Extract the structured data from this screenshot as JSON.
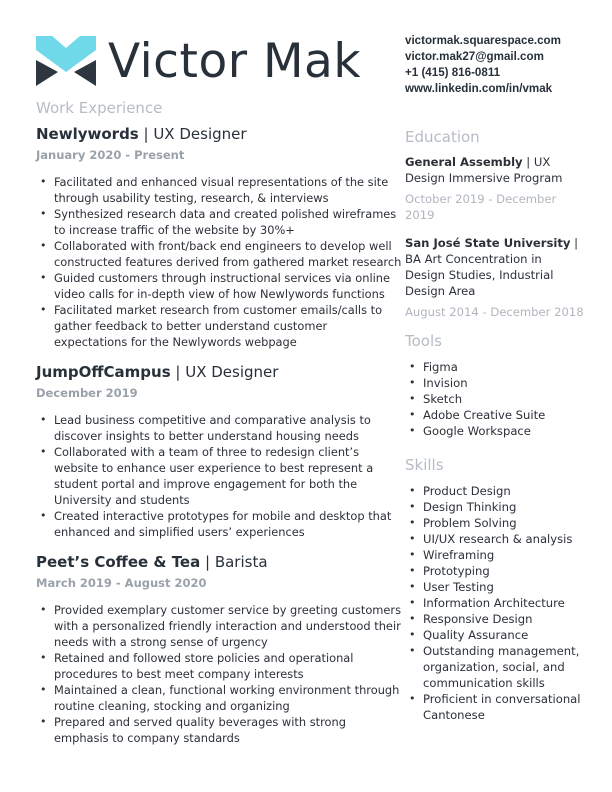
{
  "header": {
    "name": "Victor Mak",
    "logo_colors": {
      "cyan": "#6fd9ea",
      "dark": "#2e3640"
    }
  },
  "contact": {
    "website": "victormak.squarespace.com",
    "email": "victor.mak27@gmail.com",
    "phone": "+1 (415) 816-0811",
    "linkedin": "www.linkedin.com/in/vmak"
  },
  "work": {
    "section_title": "Work Experience",
    "jobs": [
      {
        "company": "Newlywords",
        "separator": " | ",
        "role": "UX Designer",
        "dates": "January 2020 - Present",
        "bullets": [
          "Facilitated and enhanced visual representations of the site through usability testing, research, & interviews",
          "Synthesized research data and created polished wireframes to increase traffic of the website by 30%+",
          "Collaborated with front/back end engineers to develop well constructed features derived from gathered market research",
          "Guided customers through instructional services via online video calls for in-depth view of how Newlywords functions",
          "Facilitated market research from customer emails/calls to gather feedback to better understand customer expectations for the Newlywords webpage"
        ]
      },
      {
        "company": "JumpOffCampus",
        "separator": " | ",
        "role": "UX Designer",
        "dates": "December 2019",
        "bullets": [
          "Lead business competitive and comparative analysis to discover insights to better understand housing needs",
          "Collaborated with a team of three to redesign client’s website to enhance user experience to best represent a student portal and improve engagement for both the University and students",
          "Created interactive prototypes for mobile and desktop that enhanced and simplified users’ experiences"
        ]
      },
      {
        "company": "Peet’s Coffee & Tea",
        "separator": " | ",
        "role": "Barista",
        "dates": "March 2019 - August 2020",
        "bullets": [
          "Provided exemplary customer service by greeting customers with a personalized friendly interaction and understood their needs with a strong sense of urgency",
          "Retained and followed store policies and operational procedures to best meet company interests",
          "Maintained a clean, functional working environment through routine cleaning, stocking and organizing",
          "Prepared and served quality beverages with strong emphasis to company standards"
        ]
      }
    ]
  },
  "education": {
    "section_title": "Education",
    "entries": [
      {
        "school": "General Assembly",
        "separator": " | ",
        "program": "UX Design Immersive Program",
        "dates": "October 2019 - December 2019"
      },
      {
        "school": "San José State University",
        "separator": " | ",
        "program": "BA Art Concentration in Design Studies, Industrial Design Area",
        "dates": "August 2014 - December 2018"
      }
    ]
  },
  "tools": {
    "section_title": "Tools",
    "items": [
      "Figma",
      "Invision",
      "Sketch",
      "Adobe Creative Suite",
      "Google Workspace"
    ]
  },
  "skills": {
    "section_title": "Skills",
    "items": [
      "Product Design",
      "Design Thinking",
      "Problem Solving",
      "UI/UX research & analysis",
      "Wireframing",
      "Prototyping",
      "User Testing",
      "Information Architecture",
      "Responsive Design",
      "Quality Assurance",
      "Outstanding management, organization, social, and communication skills",
      "Proficient in conversational Cantonese"
    ]
  }
}
